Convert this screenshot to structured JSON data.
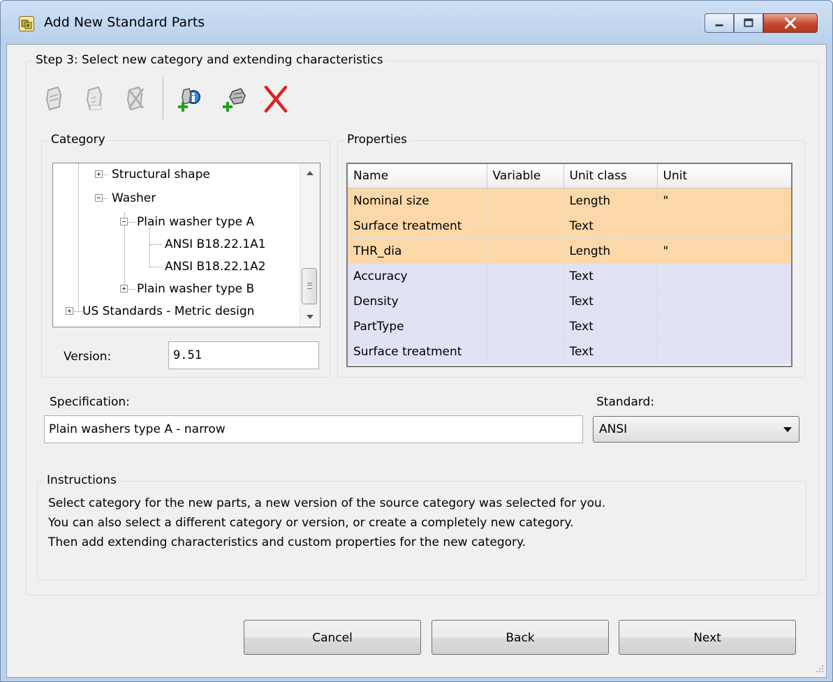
{
  "window": {
    "title": "Add New Standard Parts"
  },
  "step": {
    "title": "Step 3: Select new category and extending characteristics"
  },
  "toolbar": {
    "buttons": [
      {
        "icon": "add-category-icon",
        "enabled": false
      },
      {
        "icon": "edit-category-icon",
        "enabled": false
      },
      {
        "icon": "delete-category-icon",
        "enabled": false
      },
      {
        "icon": "add-property-icon",
        "enabled": true
      },
      {
        "icon": "add-characteristic-icon",
        "enabled": true
      },
      {
        "icon": "delete-icon",
        "enabled": true
      }
    ]
  },
  "category": {
    "legend": "Category",
    "tree": [
      {
        "label": "Structural shape",
        "level": 1,
        "expander": "plus"
      },
      {
        "label": "Washer",
        "level": 1,
        "expander": "minus"
      },
      {
        "label": "Plain washer type A",
        "level": 2,
        "expander": "minus"
      },
      {
        "label": "ANSI B18.22.1A1",
        "level": 3,
        "expander": "none"
      },
      {
        "label": "ANSI B18.22.1A2",
        "level": 3,
        "expander": "none"
      },
      {
        "label": "Plain washer type B",
        "level": 2,
        "expander": "plus"
      },
      {
        "label": "US Standards - Metric design",
        "level": 0,
        "expander": "plus"
      }
    ],
    "version_label": "Version:",
    "version_value": "9.51"
  },
  "properties": {
    "legend": "Properties",
    "columns": [
      "Name",
      "Variable",
      "Unit class",
      "Unit"
    ],
    "rows": [
      {
        "name": "Nominal size",
        "variable": "",
        "unit_class": "Length",
        "unit": "\"",
        "style": "orange"
      },
      {
        "name": "Surface treatment",
        "variable": "",
        "unit_class": "Text",
        "unit": "",
        "style": "orange"
      },
      {
        "name": "THR_dia",
        "variable": "",
        "unit_class": "Length",
        "unit": "\"",
        "style": "orange"
      },
      {
        "name": "Accuracy",
        "variable": "",
        "unit_class": "Text",
        "unit": "",
        "style": "lav"
      },
      {
        "name": "Density",
        "variable": "",
        "unit_class": "Text",
        "unit": "",
        "style": "lav"
      },
      {
        "name": "PartType",
        "variable": "",
        "unit_class": "Text",
        "unit": "",
        "style": "lav"
      },
      {
        "name": "Surface treatment",
        "variable": "",
        "unit_class": "Text",
        "unit": "",
        "style": "lav"
      }
    ]
  },
  "specification": {
    "label": "Specification:",
    "value": "Plain washers type A - narrow"
  },
  "standard": {
    "label": "Standard:",
    "value": "ANSI"
  },
  "instructions": {
    "legend": "Instructions",
    "lines": [
      "Select category for the new parts, a new version of the source category was selected for you.",
      "You can also select a different category or version, or create a completely new category.",
      "Then add extending characteristics and custom properties for the new category."
    ]
  },
  "buttons": {
    "cancel": "Cancel",
    "back": "Back",
    "next": "Next"
  },
  "colors": {
    "standard_row": "#fcd8a8",
    "custom_row": "#e2e2f5",
    "close_button": "#c44a2e",
    "delete_icon": "#e02020"
  }
}
